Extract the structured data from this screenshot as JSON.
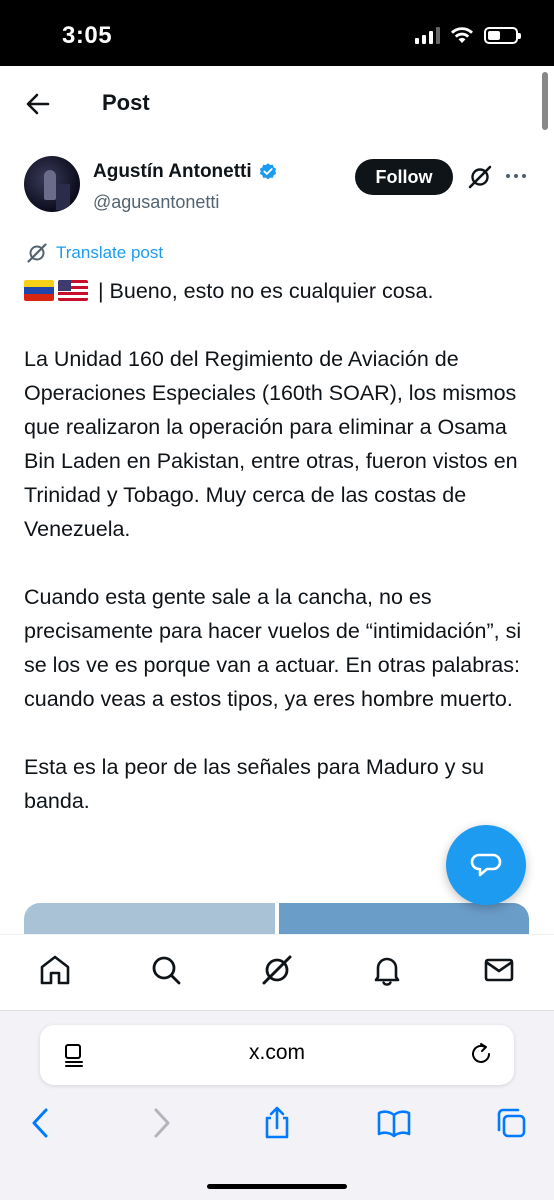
{
  "status_bar": {
    "time": "3:05"
  },
  "header": {
    "title": "Post"
  },
  "author": {
    "name": "Agustín Antonetti",
    "handle": "@agusantonetti",
    "follow_label": "Follow"
  },
  "post": {
    "translate_label": "Translate post",
    "line1": "| Bueno, esto no es cualquier cosa.",
    "paragraph2": "La Unidad 160 del Regimiento de Aviación de Operaciones Especiales (160th SOAR), los mismos que realizaron la operación para eliminar a Osama Bin Laden en Pakistan, entre otras, fueron vistos en Trinidad y Tobago. Muy cerca de las costas de Venezuela.",
    "paragraph3": "Cuando esta gente sale a la cancha, no es precisamente para hacer vuelos de “intimidación”, si se los ve es porque van a actuar. En otras palabras: cuando veas a estos tipos, ya eres hombre muerto.",
    "paragraph4": "Esta es la peor de las señales para Maduro y su banda."
  },
  "safari": {
    "url": "x.com"
  },
  "colors": {
    "accent": "#1d9bf0",
    "text": "#0f1419",
    "muted": "#536471",
    "safari_blue": "#007aff"
  },
  "icons": {
    "nav": [
      "home-icon",
      "search-icon",
      "grok-icon",
      "notifications-icon",
      "messages-icon"
    ],
    "safari_toolbar": [
      "back-icon",
      "forward-icon",
      "share-icon",
      "bookmarks-icon",
      "tabs-icon"
    ]
  }
}
